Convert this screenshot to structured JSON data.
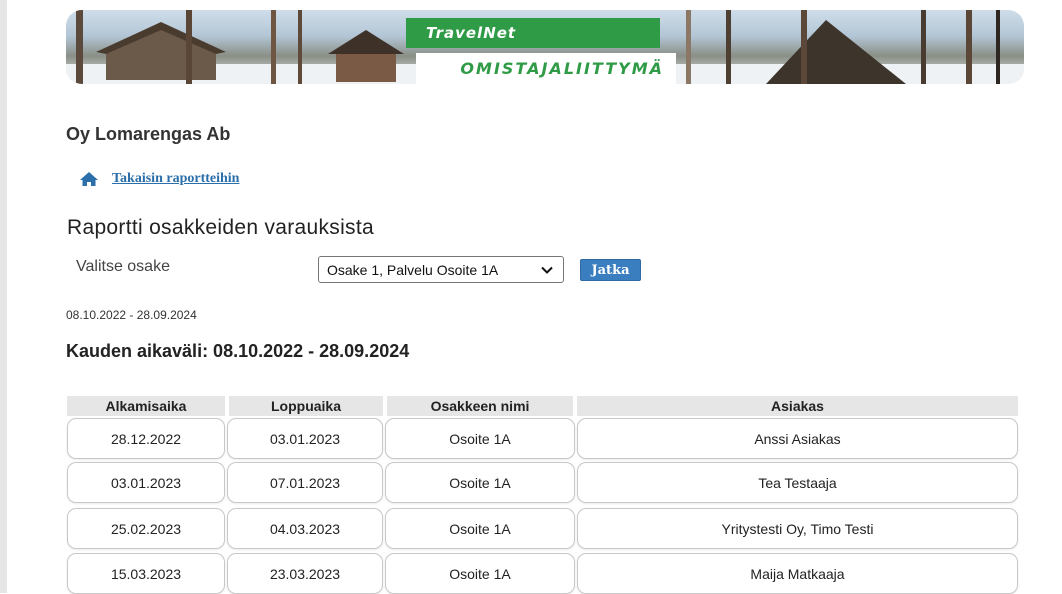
{
  "banner": {
    "logo_top": "TravelNet",
    "logo_bottom": "OMISTAJALIITTYMÄ"
  },
  "company_name": "Oy Lomarengas Ab",
  "back_link": {
    "icon": "home-icon",
    "label": "Takaisin raportteihin"
  },
  "report_title": "Raportti osakkeiden varauksista",
  "selector": {
    "label": "Valitse osake",
    "selected": "Osake 1, Palvelu Osoite 1A",
    "button_label": "Jatka"
  },
  "date_range_small": "08.10.2022 - 28.09.2024",
  "period_title": "Kauden aikaväli: 08.10.2022 - 28.09.2024",
  "table": {
    "columns": [
      "Alkamisaika",
      "Loppuaika",
      "Osakkeen nimi",
      "Asiakas"
    ],
    "rows": [
      [
        "28.12.2022",
        "03.01.2023",
        "Osoite 1A",
        "Anssi Asiakas"
      ],
      [
        "03.01.2023",
        "07.01.2023",
        "Osoite 1A",
        "Tea Testaaja"
      ],
      [
        "25.02.2023",
        "04.03.2023",
        "Osoite 1A",
        "Yritystesti Oy, Timo Testi"
      ],
      [
        "15.03.2023",
        "23.03.2023",
        "Osoite 1A",
        "Maija Matkaaja"
      ]
    ]
  },
  "colors": {
    "brand_green": "#2f9b46",
    "link_blue": "#2a6eaa",
    "button_blue": "#3b7ec0",
    "header_gray": "#e6e6e6"
  }
}
